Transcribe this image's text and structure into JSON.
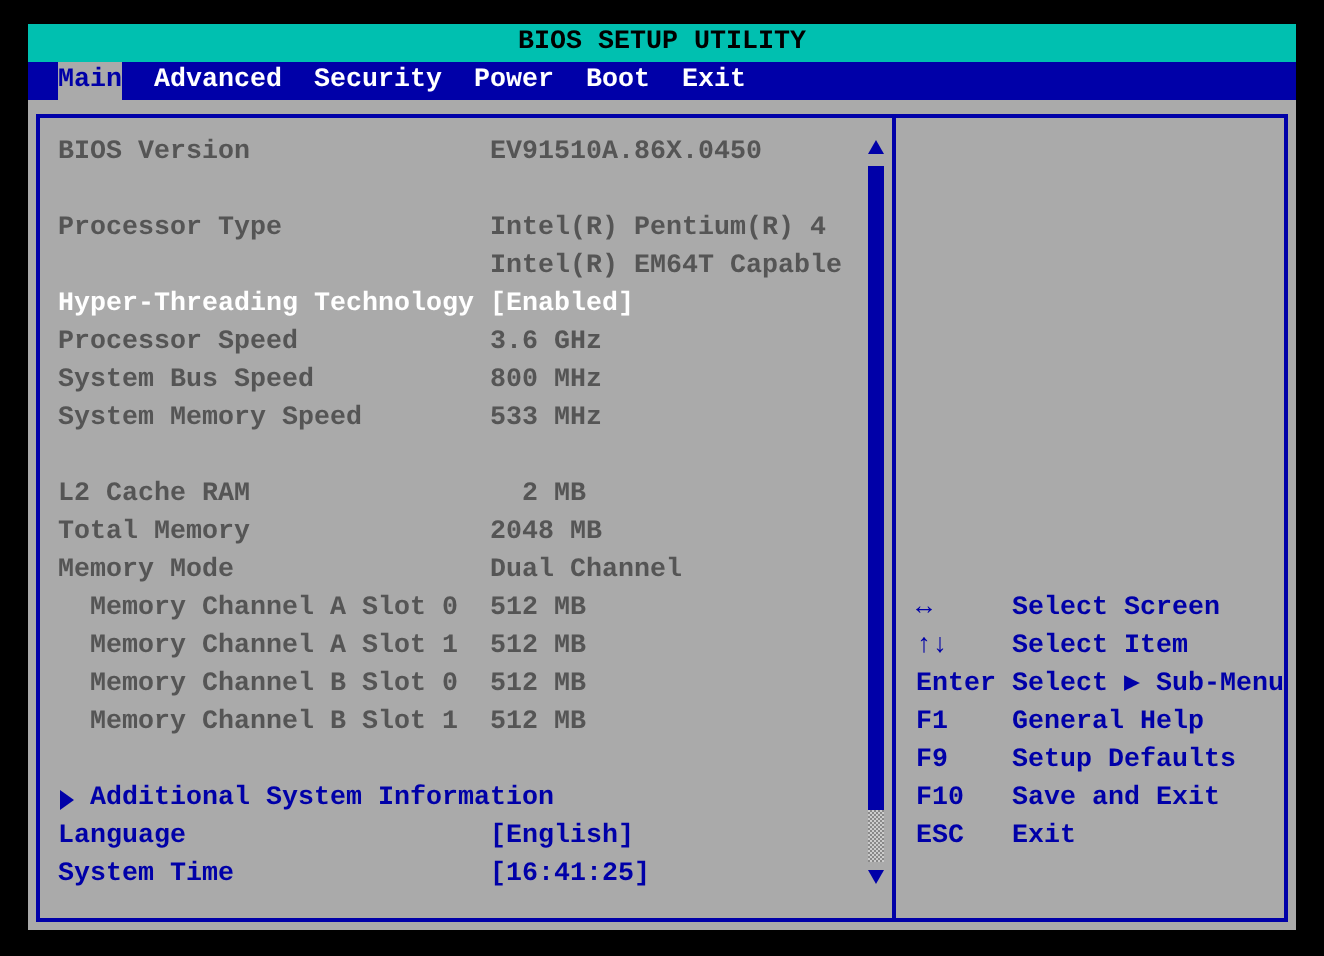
{
  "title": "BIOS SETUP UTILITY",
  "tabs": [
    {
      "label": "Main",
      "selected": true
    },
    {
      "label": "Advanced",
      "selected": false
    },
    {
      "label": "Security",
      "selected": false
    },
    {
      "label": "Power",
      "selected": false
    },
    {
      "label": "Boot",
      "selected": false
    },
    {
      "label": "Exit",
      "selected": false
    }
  ],
  "sections": [
    [
      {
        "kind": "info",
        "label": "BIOS Version",
        "values": [
          "EV91510A.86X.0450"
        ],
        "selected": false
      }
    ],
    [
      {
        "kind": "info",
        "label": "Processor Type",
        "values": [
          "Intel(R) Pentium(R) 4",
          "Intel(R) EM64T Capable"
        ],
        "selected": false
      },
      {
        "kind": "option",
        "label": "Hyper-Threading Technology",
        "values": [
          "[Enabled]"
        ],
        "selected": true
      },
      {
        "kind": "info",
        "label": "Processor Speed",
        "values": [
          "3.6 GHz"
        ],
        "selected": false
      },
      {
        "kind": "info",
        "label": "System Bus Speed",
        "values": [
          "800 MHz"
        ],
        "selected": false
      },
      {
        "kind": "info",
        "label": "System Memory Speed",
        "values": [
          "533 MHz"
        ],
        "selected": false
      }
    ],
    [
      {
        "kind": "info",
        "label": "L2 Cache RAM",
        "values": [
          "  2 MB"
        ],
        "selected": false
      },
      {
        "kind": "info",
        "label": "Total Memory",
        "values": [
          "2048 MB"
        ],
        "selected": false
      },
      {
        "kind": "info",
        "label": "Memory Mode",
        "values": [
          "Dual Channel"
        ],
        "selected": false
      },
      {
        "kind": "sub",
        "label": "Memory Channel A Slot 0",
        "values": [
          "512 MB"
        ],
        "selected": false
      },
      {
        "kind": "sub",
        "label": "Memory Channel A Slot 1",
        "values": [
          "512 MB"
        ],
        "selected": false
      },
      {
        "kind": "sub",
        "label": "Memory Channel B Slot 0",
        "values": [
          "512 MB"
        ],
        "selected": false
      },
      {
        "kind": "sub",
        "label": "Memory Channel B Slot 1",
        "values": [
          "512 MB"
        ],
        "selected": false
      }
    ],
    [
      {
        "kind": "submenu",
        "label": "Additional System Information",
        "selected": false
      },
      {
        "kind": "option",
        "label": "Language",
        "values": [
          "[English]"
        ],
        "selected": false
      },
      {
        "kind": "option",
        "label": "System Time",
        "values": [
          "[16:41:25]"
        ],
        "selected": false
      }
    ]
  ],
  "help": [
    {
      "key": "↔",
      "action": "Select Screen"
    },
    {
      "key": "↑↓",
      "action": "Select Item"
    },
    {
      "key": "Enter",
      "action": "Select ▶ Sub-Menu"
    },
    {
      "key": "F1",
      "action": "General Help"
    },
    {
      "key": "F9",
      "action": "Setup Defaults"
    },
    {
      "key": "F10",
      "action": "Save and Exit"
    },
    {
      "key": "ESC",
      "action": "Exit"
    }
  ]
}
